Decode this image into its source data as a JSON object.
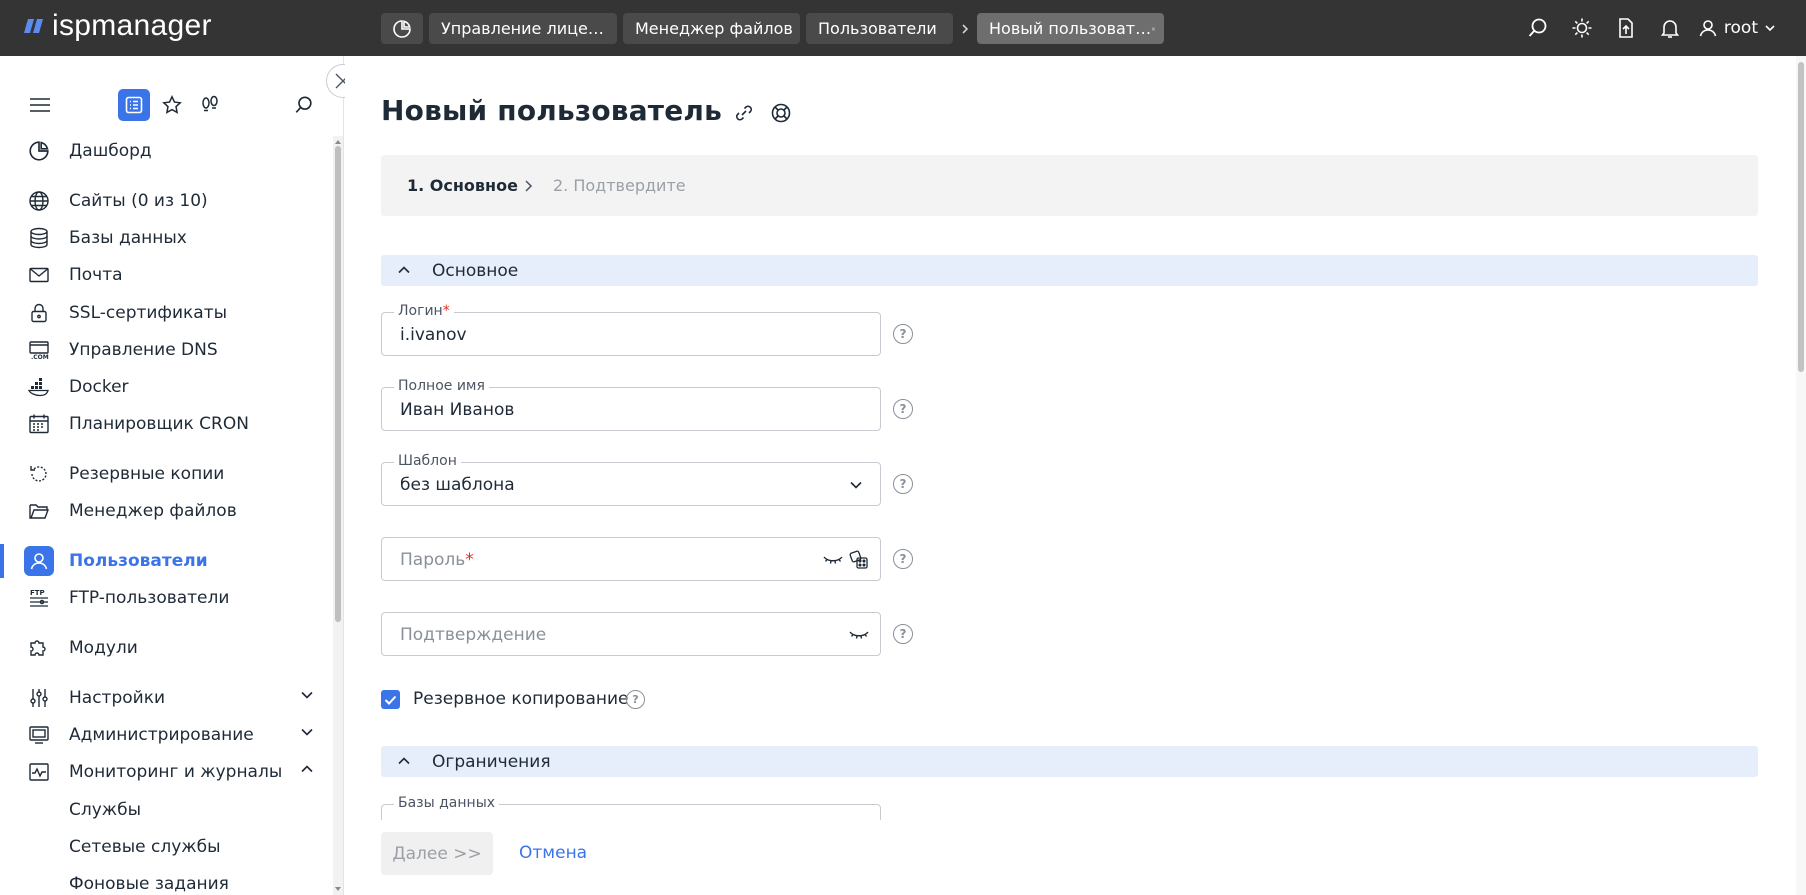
{
  "app": {
    "logo_text": "ispmanager"
  },
  "tabs": [
    {
      "label": "Управление лице…"
    },
    {
      "label": "Менеджер файлов"
    },
    {
      "label": "Пользователи"
    },
    {
      "label": "Новый пользоват…"
    }
  ],
  "header": {
    "user_name": "root"
  },
  "sidebar": {
    "items": [
      {
        "label": "Дашборд",
        "icon": "chart-pie-icon"
      },
      {
        "label": "Сайты (0 из 10)",
        "icon": "globe-icon"
      },
      {
        "label": "Базы данных",
        "icon": "database-icon"
      },
      {
        "label": "Почта",
        "icon": "mail-icon"
      },
      {
        "label": "SSL-сертификаты",
        "icon": "lock-icon"
      },
      {
        "label": "Управление DNS",
        "icon": "dns-icon"
      },
      {
        "label": "Docker",
        "icon": "docker-icon"
      },
      {
        "label": "Планировщик CRON",
        "icon": "calendar-icon"
      },
      {
        "label": "Резервные копии",
        "icon": "backup-icon"
      },
      {
        "label": "Менеджер файлов",
        "icon": "folder-icon"
      },
      {
        "label": "Пользователи",
        "icon": "user-icon",
        "active": true
      },
      {
        "label": "FTP-пользователи",
        "icon": "ftp-icon"
      },
      {
        "label": "Модули",
        "icon": "puzzle-icon"
      },
      {
        "label": "Настройки",
        "icon": "sliders-icon",
        "expandable": "collapsed"
      },
      {
        "label": "Администрирование",
        "icon": "monitor-icon",
        "expandable": "collapsed"
      },
      {
        "label": "Мониторинг и журналы",
        "icon": "activity-icon",
        "expandable": "expanded"
      },
      {
        "label": "Службы",
        "sub": true
      },
      {
        "label": "Сетевые службы",
        "sub": true
      },
      {
        "label": "Фоновые задания",
        "sub": true
      }
    ]
  },
  "page": {
    "title": "Новый пользователь",
    "steps": [
      {
        "label": "1. Основное",
        "active": true
      },
      {
        "label": "2. Подтвердите",
        "active": false
      }
    ]
  },
  "form": {
    "section_main": "Основное",
    "login": {
      "label": "Логин",
      "required_mark": "*",
      "value": "i.ivanov"
    },
    "full_name": {
      "label": "Полное имя",
      "value": "Иван Иванов"
    },
    "template": {
      "label": "Шаблон",
      "value": "без шаблона"
    },
    "password": {
      "placeholder": "Пароль",
      "required_mark": "*"
    },
    "confirm": {
      "placeholder": "Подтверждение"
    },
    "backup_checkbox": {
      "label": "Резервное копирование",
      "checked": true
    },
    "section_limits": "Ограничения",
    "databases": {
      "label": "Базы данных"
    },
    "help_mark": "?"
  },
  "footer": {
    "next_label": "Далее >>",
    "cancel_label": "Отмена"
  },
  "colors": {
    "accent": "#3b74e8",
    "topbar": "#343434",
    "section_bg": "#e6edfb",
    "required": "#d93025"
  }
}
